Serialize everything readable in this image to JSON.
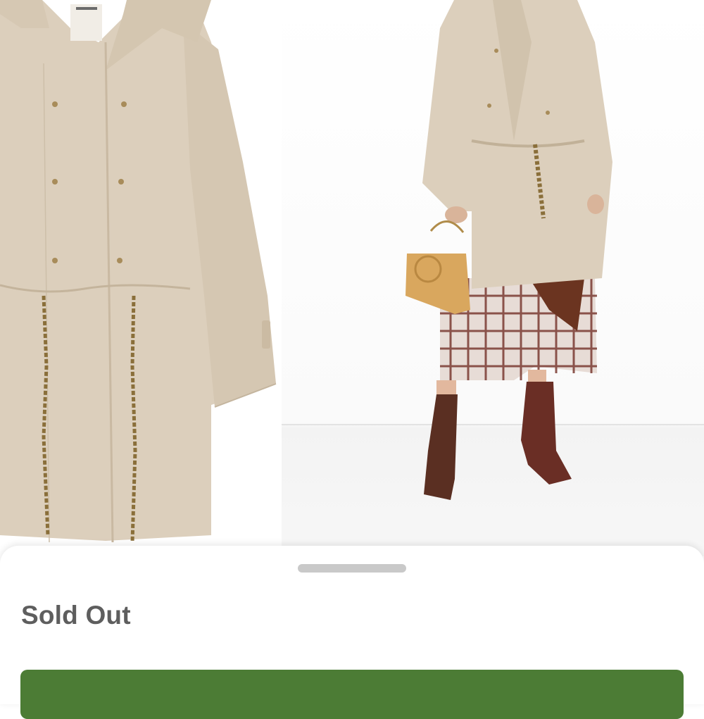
{
  "product_gallery": {
    "images": [
      {
        "name": "coat-front-view"
      },
      {
        "name": "coat-model-view"
      }
    ]
  },
  "sheet": {
    "status_label": "Sold Out",
    "primary_button_color": "#4c7c35"
  },
  "colors": {
    "coat": "#dccfbc",
    "button_green": "#4c7c35",
    "status_text": "#5e5e5e"
  }
}
